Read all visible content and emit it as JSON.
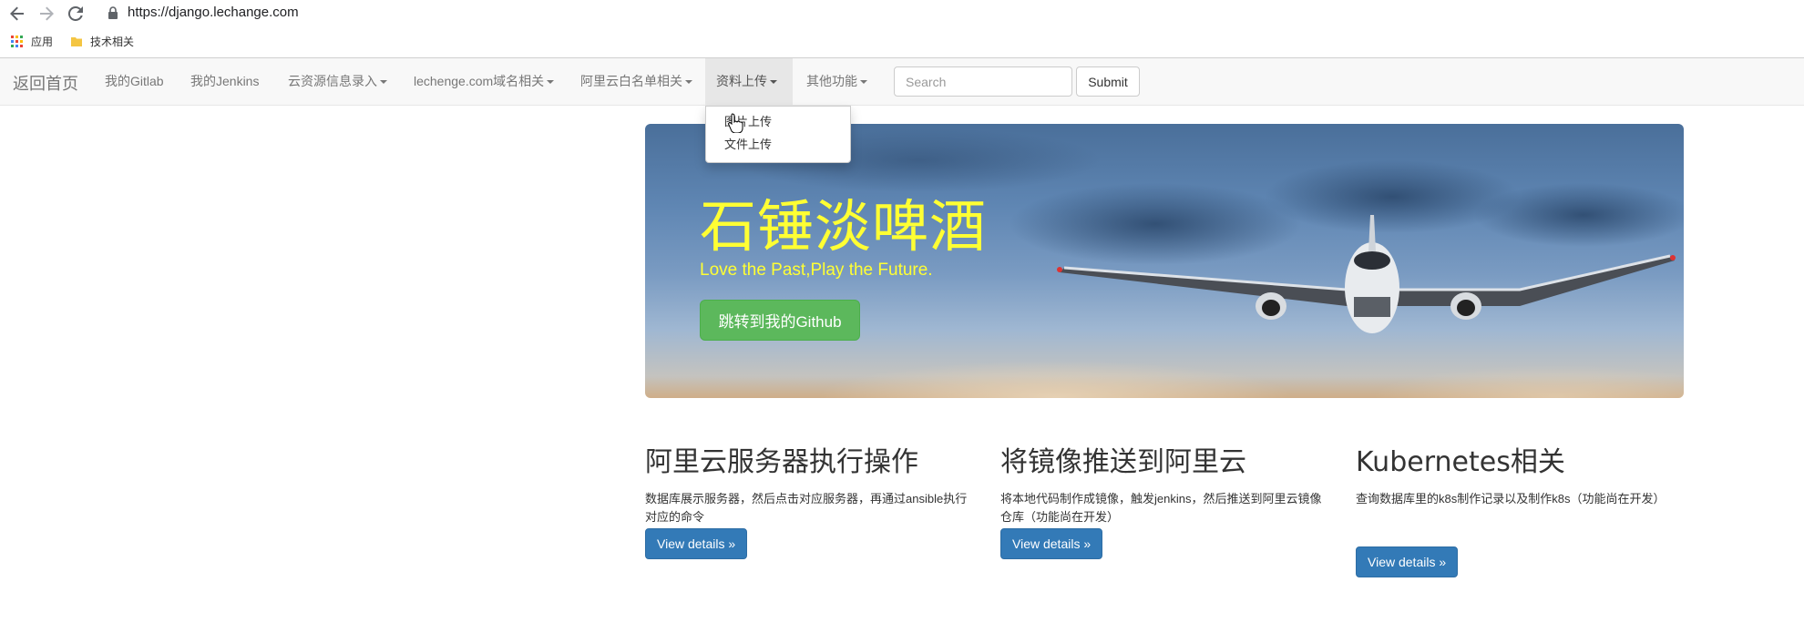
{
  "browser": {
    "url": "https://django.lechange.com",
    "bookmarks": [
      {
        "label": "应用",
        "icon": "apps-grid-icon"
      },
      {
        "label": "技术相关",
        "icon": "folder-icon"
      }
    ]
  },
  "navbar": {
    "brand": "返回首页",
    "items": [
      {
        "label": "我的Gitlab",
        "dropdown": false
      },
      {
        "label": "我的Jenkins",
        "dropdown": false
      },
      {
        "label": "云资源信息录入",
        "dropdown": true
      },
      {
        "label": "lechenge.com域名相关",
        "dropdown": true
      },
      {
        "label": "阿里云白名单相关",
        "dropdown": true
      },
      {
        "label": "资料上传",
        "dropdown": true,
        "active": true
      },
      {
        "label": "其他功能",
        "dropdown": true
      }
    ],
    "search_placeholder": "Search",
    "submit_label": "Submit"
  },
  "dropdown_menu": {
    "items": [
      "图片上传",
      "文件上传"
    ]
  },
  "jumbotron": {
    "title": "石锤淡啤酒",
    "tagline": "Love the Past,Play the Future.",
    "button_label": "跳转到我的Github",
    "title_color": "#ffff33",
    "button_color": "#5cb85c"
  },
  "columns": [
    {
      "title": "阿里云服务器执行操作",
      "text": "数据库展示服务器，然后点击对应服务器，再通过ansible执行对应的命令",
      "button": "View details »"
    },
    {
      "title": "将镜像推送到阿里云",
      "text": "将本地代码制作成镜像，触发jenkins，然后推送到阿里云镜像仓库（功能尚在开发）",
      "button": "View details »"
    },
    {
      "title": "Kubernetes相关",
      "text": "查询数据库里的k8s制作记录以及制作k8s（功能尚在开发）",
      "button": "View details »"
    }
  ],
  "colors": {
    "primary": "#337ab7",
    "navbar_bg": "#f8f8f8",
    "nav_active_bg": "#e7e7e7"
  }
}
